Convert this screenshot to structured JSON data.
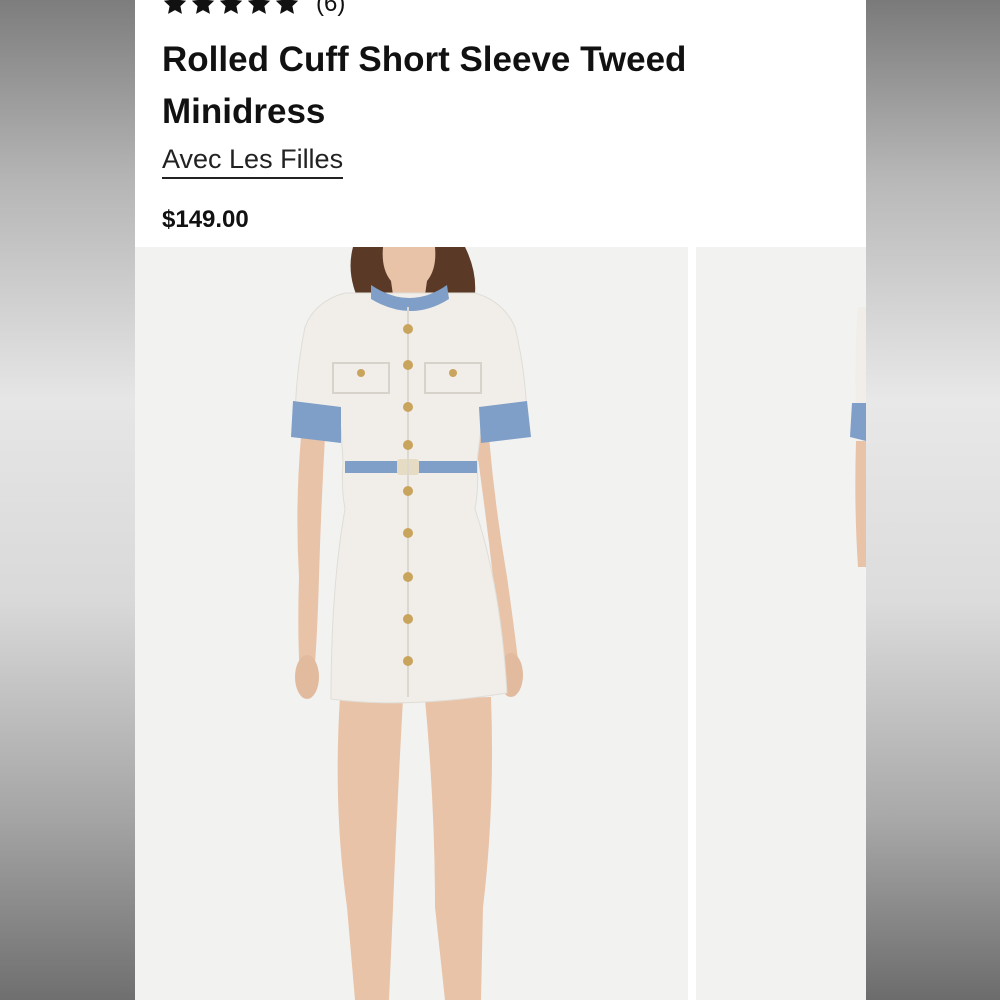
{
  "product": {
    "rating_stars": 5,
    "review_count": "(6)",
    "title": "Rolled Cuff Short Sleeve Tweed Minidress",
    "brand": "Avec Les Filles",
    "price": "$149.00"
  },
  "gallery": {
    "images": [
      {
        "subject": "model-wearing-white-tweed-minidress-front"
      },
      {
        "subject": "model-wearing-white-tweed-minidress-partial"
      }
    ]
  },
  "colors": {
    "dress": "#f1eee9",
    "denim_trim": "#7f9fc8",
    "buttons": "#c9a45c",
    "skin": "#e8c3a8",
    "hair": "#5a3a26",
    "image_bg": "#f2f2f1"
  },
  "icons": [
    "star-icon"
  ]
}
